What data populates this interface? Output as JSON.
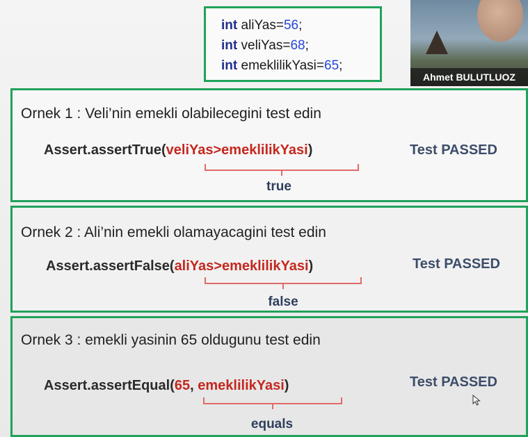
{
  "code": {
    "lines": [
      {
        "type": "int",
        "name": "aliYas",
        "value": "56"
      },
      {
        "type": "int",
        "name": "veliYas",
        "value": "68"
      },
      {
        "type": "int",
        "name": "emeklilikYasi",
        "value": "65"
      }
    ]
  },
  "webcam": {
    "name": "Ahmet BULUTLUOZ"
  },
  "examples": [
    {
      "title": "Ornek 1 : Veli’nin emekli olabilecegini test edin",
      "method": "Assert.assertTrue(",
      "args": "veliYas>emeklilikYasi",
      "close": ")",
      "status": "Test PASSED",
      "result": "true"
    },
    {
      "title": "Ornek 2 : Ali’nin emekli olamayacagini test edin",
      "method": "Assert.assertFalse(",
      "args": "aliYas>emeklilikYasi",
      "close": ")",
      "status": "Test PASSED",
      "result": "false"
    },
    {
      "title": "Ornek 3 : emekli yasinin 65 oldugunu test edin",
      "method": "Assert.assertEqual(",
      "args_a": "65",
      "sep": ",",
      "args_b": "emeklilikYasi",
      "close": ")",
      "status": "Test PASSED",
      "result": "equals"
    }
  ],
  "colors": {
    "border": "#1fa25b",
    "arg": "#c4281f",
    "keyword": "#1f2f8a",
    "number": "#2646d8",
    "status": "#3c4d6a"
  }
}
